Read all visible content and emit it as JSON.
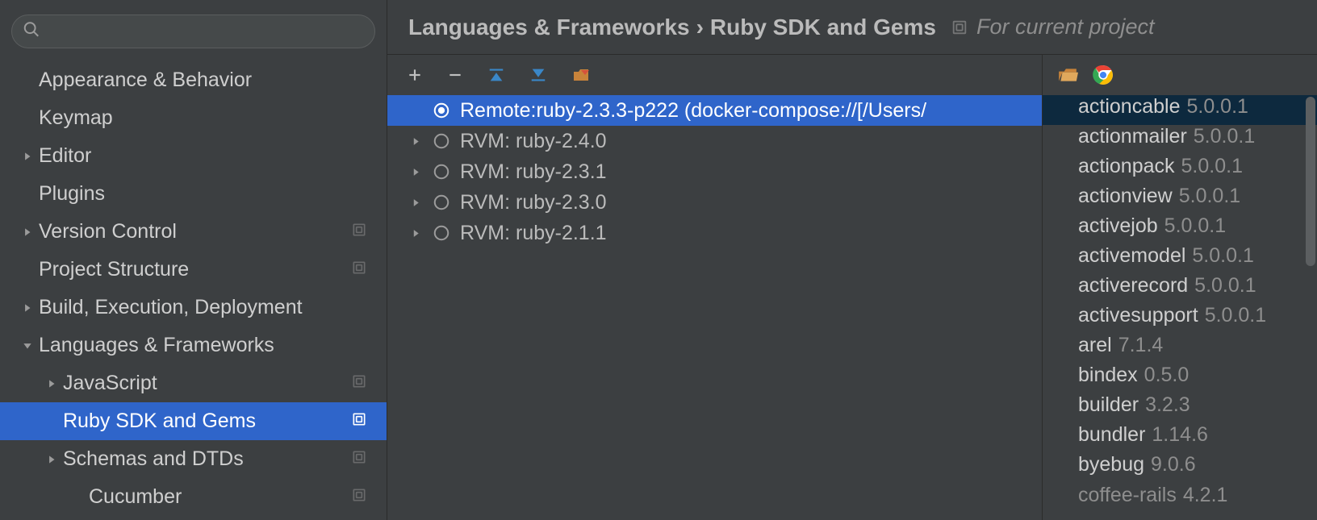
{
  "sidebar": {
    "searchPlaceholder": "",
    "items": [
      {
        "label": "Appearance & Behavior",
        "caret": false,
        "indent": 0,
        "proj": false
      },
      {
        "label": "Keymap",
        "caret": false,
        "indent": 0,
        "proj": false
      },
      {
        "label": "Editor",
        "caret": true,
        "indent": 0,
        "proj": false
      },
      {
        "label": "Plugins",
        "caret": false,
        "indent": 0,
        "proj": false
      },
      {
        "label": "Version Control",
        "caret": true,
        "indent": 0,
        "proj": true
      },
      {
        "label": "Project Structure",
        "caret": false,
        "indent": 0,
        "proj": true
      },
      {
        "label": "Build, Execution, Deployment",
        "caret": true,
        "indent": 0,
        "proj": false
      },
      {
        "label": "Languages & Frameworks",
        "caret": true,
        "open": true,
        "indent": 0,
        "proj": false
      },
      {
        "label": "JavaScript",
        "caret": true,
        "indent": 1,
        "proj": true
      },
      {
        "label": "Ruby SDK and Gems",
        "caret": false,
        "indent": 1,
        "proj": true,
        "selected": true
      },
      {
        "label": "Schemas and DTDs",
        "caret": true,
        "indent": 1,
        "proj": true
      },
      {
        "label": "Cucumber",
        "caret": false,
        "indent": 2,
        "proj": true
      }
    ]
  },
  "breadcrumb": {
    "parent": "Languages & Frameworks",
    "separator": "›",
    "current": "Ruby SDK and Gems",
    "scope": "For current project"
  },
  "toolbar": {
    "add": "add-sdk",
    "remove": "remove-sdk",
    "up": "collapse-up",
    "down": "collapse-down",
    "editPath": "edit-path"
  },
  "sdks": [
    {
      "name": "Remote:ruby-2.3.3-p222 (docker-compose://[/Users/",
      "selected": true,
      "checked": true
    },
    {
      "name": "RVM: ruby-2.4.0",
      "selected": false
    },
    {
      "name": "RVM: ruby-2.3.1",
      "selected": false
    },
    {
      "name": "RVM: ruby-2.3.0",
      "selected": false
    },
    {
      "name": "RVM: ruby-2.1.1",
      "selected": false
    }
  ],
  "gems": [
    {
      "name": "actioncable",
      "ver": "5.0.0.1",
      "selected": true
    },
    {
      "name": "actionmailer",
      "ver": "5.0.0.1"
    },
    {
      "name": "actionpack",
      "ver": "5.0.0.1"
    },
    {
      "name": "actionview",
      "ver": "5.0.0.1"
    },
    {
      "name": "activejob",
      "ver": "5.0.0.1"
    },
    {
      "name": "activemodel",
      "ver": "5.0.0.1"
    },
    {
      "name": "activerecord",
      "ver": "5.0.0.1"
    },
    {
      "name": "activesupport",
      "ver": "5.0.0.1"
    },
    {
      "name": "arel",
      "ver": "7.1.4"
    },
    {
      "name": "bindex",
      "ver": "0.5.0"
    },
    {
      "name": "builder",
      "ver": "3.2.3"
    },
    {
      "name": "bundler",
      "ver": "1.14.6"
    },
    {
      "name": "byebug",
      "ver": "9.0.6"
    },
    {
      "name": "coffee-rails",
      "ver": "4.2.1",
      "last": true
    }
  ]
}
